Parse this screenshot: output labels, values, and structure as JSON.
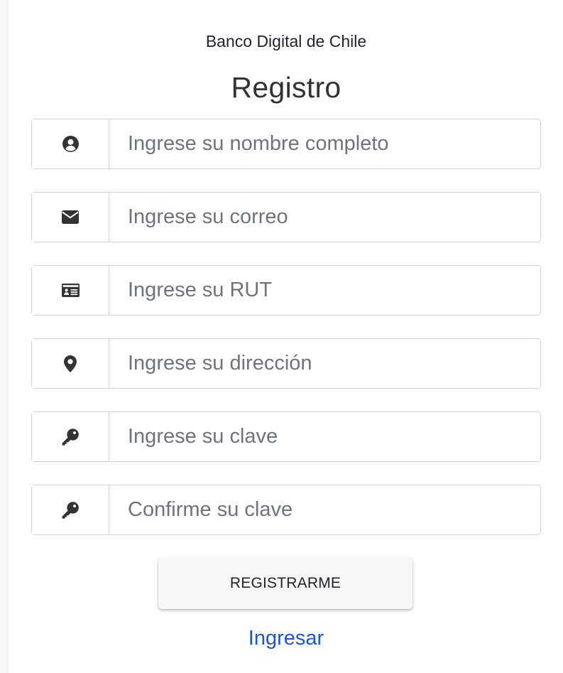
{
  "header": {
    "bank_name": "Banco Digital de Chile",
    "title": "Registro"
  },
  "form": {
    "fields": [
      {
        "icon": "user-circle-icon",
        "placeholder": "Ingrese su nombre completo",
        "value": ""
      },
      {
        "icon": "envelope-icon",
        "placeholder": "Ingrese su correo",
        "value": ""
      },
      {
        "icon": "id-card-icon",
        "placeholder": "Ingrese su RUT",
        "value": ""
      },
      {
        "icon": "map-marker-icon",
        "placeholder": "Ingrese su dirección",
        "value": ""
      },
      {
        "icon": "key-icon",
        "placeholder": "Ingrese su clave",
        "value": ""
      },
      {
        "icon": "key-icon",
        "placeholder": "Confirme su clave",
        "value": ""
      }
    ],
    "submit_label": "REGISTRARME",
    "login_link_label": "Ingresar"
  },
  "colors": {
    "icon": "#333333",
    "link": "#1a56db",
    "border": "#cfd4d9",
    "button_bg": "#f6f6f6"
  }
}
